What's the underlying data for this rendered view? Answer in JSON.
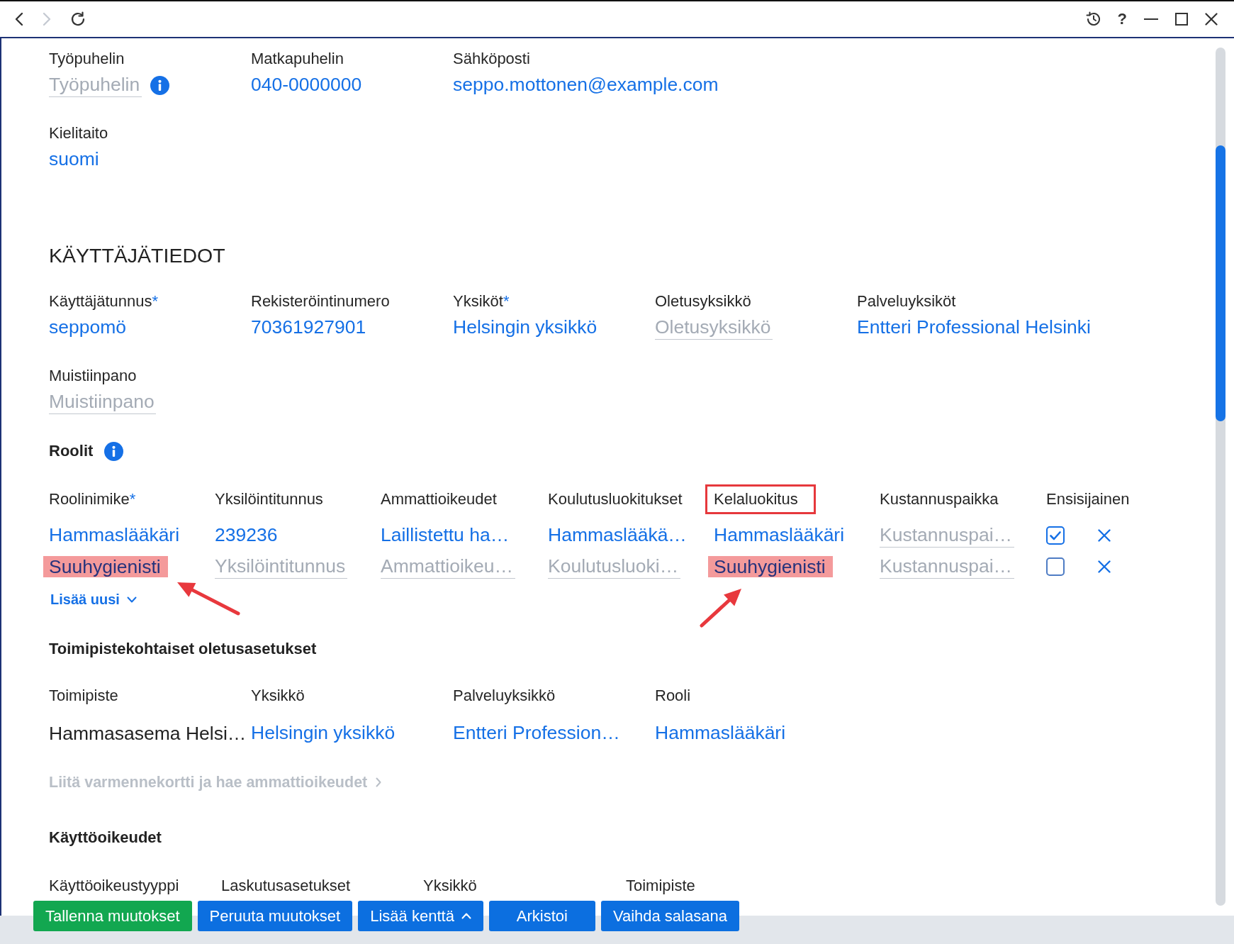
{
  "toolbar": {
    "nav_buttons": [
      {
        "kind": "back",
        "disabled": false
      },
      {
        "kind": "forward",
        "disabled": true
      },
      {
        "kind": "reload",
        "disabled": false
      }
    ],
    "window_buttons": [
      {
        "kind": "history"
      },
      {
        "kind": "help",
        "label": "?"
      },
      {
        "kind": "minimize"
      },
      {
        "kind": "maximize"
      },
      {
        "kind": "close"
      }
    ]
  },
  "contact": {
    "rows": [
      [
        {
          "label": "Työpuhelin",
          "placeholder": "Työpuhelin",
          "info": true
        },
        {
          "label": "Matkapuhelin",
          "value": "040-0000000",
          "info": false
        },
        {
          "label": "Sähköposti",
          "value": "seppo.mottonen@example.com",
          "info": false
        }
      ],
      [
        {
          "label": "Kielitaito",
          "value": "suomi",
          "info": false
        }
      ]
    ]
  },
  "user_info": {
    "title": "KÄYTTÄJÄTIEDOT",
    "rows": [
      [
        {
          "label": "Käyttäjätunnus",
          "required_mark": "*",
          "value": "seppomö"
        },
        {
          "label": "Rekisteröintinumero",
          "value": "70361927901"
        },
        {
          "label": "Yksiköt",
          "required_mark": "*",
          "value": "Helsingin yksikkö"
        },
        {
          "label": "Oletusyksikkö",
          "placeholder": "Oletusyksikkö"
        },
        {
          "label": "Palveluyksiköt",
          "value": "Entteri Professional Helsinki"
        }
      ],
      [
        {
          "label": "Muistiinpano",
          "placeholder": "Muistiinpano"
        }
      ]
    ]
  },
  "roles": {
    "title": "Roolit",
    "info": true,
    "columns": [
      {
        "label": "Roolinimike",
        "required_mark": "*",
        "boxed": false
      },
      {
        "label": "Yksilöintitunnus",
        "boxed": false
      },
      {
        "label": "Ammattioikeudet",
        "boxed": false
      },
      {
        "label": "Koulutusluokitukset",
        "boxed": false
      },
      {
        "label": "Kelaluokitus",
        "boxed": true
      },
      {
        "label": "Kustannuspaikka",
        "boxed": false
      },
      {
        "label": "Ensisijainen",
        "boxed": false
      }
    ],
    "rows": [
      {
        "cells": [
          {
            "value": "Hammaslääkäri",
            "highlighted": false
          },
          {
            "value": "239236",
            "highlighted": false
          },
          {
            "value": "Laillistettu ha…",
            "highlighted": false
          },
          {
            "value": "Hammaslääkä…",
            "highlighted": false
          },
          {
            "value": "Hammaslääkäri",
            "highlighted": false
          },
          {
            "placeholder": "Kustannuspai…",
            "highlighted": false
          }
        ],
        "checked": true
      },
      {
        "cells": [
          {
            "value": "Suuhygienisti",
            "highlighted": true,
            "arrow": {
              "kind": "up-left"
            }
          },
          {
            "placeholder": "Yksilöintitunnus",
            "highlighted": false
          },
          {
            "placeholder": "Ammattioikeu…",
            "highlighted": false
          },
          {
            "placeholder": "Koulutusluoki…",
            "highlighted": false
          },
          {
            "value": "Suuhygienisti",
            "highlighted": true,
            "arrow": {
              "kind": "up-right"
            }
          },
          {
            "placeholder": "Kustannuspai…",
            "highlighted": false
          }
        ],
        "checked": false
      }
    ],
    "add_button": {
      "label": "Lisää uusi"
    }
  },
  "site_defaults": {
    "title": "Toimipistekohtaiset oletusasetukset",
    "fields": [
      {
        "label": "Toimipiste",
        "kind": "static",
        "value": "Hammasasema Helsi…"
      },
      {
        "label": "Yksikkö",
        "kind": "select",
        "value": "Helsingin yksikkö"
      },
      {
        "label": "Palveluyksikkö",
        "kind": "select",
        "value": "Entteri Profession…"
      },
      {
        "label": "Rooli",
        "kind": "select",
        "value": "Hammaslääkäri"
      }
    ],
    "link": {
      "label": "Liitä varmennekortti ja hae ammattioikeudet",
      "disabled": true
    }
  },
  "access_rights": {
    "title": "Käyttöoikeudet",
    "columns": [
      {
        "label": "Käyttöoikeustyyppi"
      },
      {
        "label": "Laskutusasetukset"
      },
      {
        "label": "Yksikkö"
      },
      {
        "label": "Toimipiste"
      }
    ]
  },
  "footer_buttons": [
    {
      "label": "Tallenna muutokset",
      "kind": "primary"
    },
    {
      "label": "Peruuta muutokset",
      "kind": "secondary"
    },
    {
      "label": "Lisää kenttä",
      "kind": "menu"
    },
    {
      "label": "Arkistoi",
      "kind": "secondary"
    },
    {
      "label": "Vaihda salasana",
      "kind": "secondary"
    }
  ]
}
